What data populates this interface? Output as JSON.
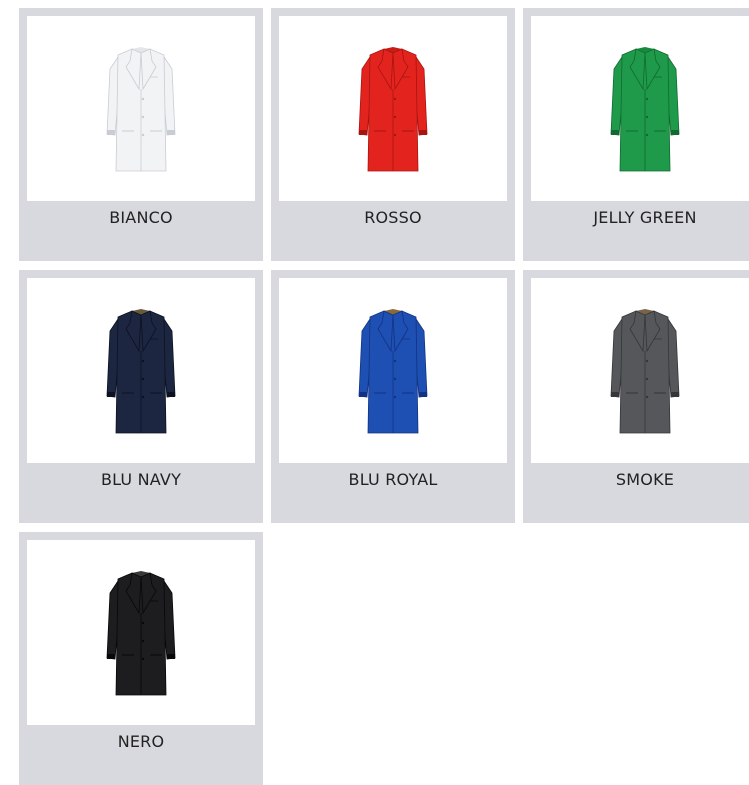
{
  "swatches": [
    {
      "label": "BIANCO",
      "color": "#f2f3f5",
      "shade": "#c9ccd2",
      "lining": "#e4e6ea"
    },
    {
      "label": "ROSSO",
      "color": "#e3241e",
      "shade": "#a91410",
      "lining": "#c81c17"
    },
    {
      "label": "JELLY GREEN",
      "color": "#1f9a4a",
      "shade": "#116a31",
      "lining": "#188a40"
    },
    {
      "label": "BLU NAVY",
      "color": "#1c2640",
      "shade": "#0c1222",
      "lining": "#6b5a3a"
    },
    {
      "label": "BLU ROYAL",
      "color": "#1e4fb3",
      "shade": "#123383",
      "lining": "#8a6a3a"
    },
    {
      "label": "SMOKE",
      "color": "#55575b",
      "shade": "#35363a",
      "lining": "#7a6448"
    },
    {
      "label": "NERO",
      "color": "#1d1d1f",
      "shade": "#08080a",
      "lining": "#3a3a3c"
    }
  ]
}
